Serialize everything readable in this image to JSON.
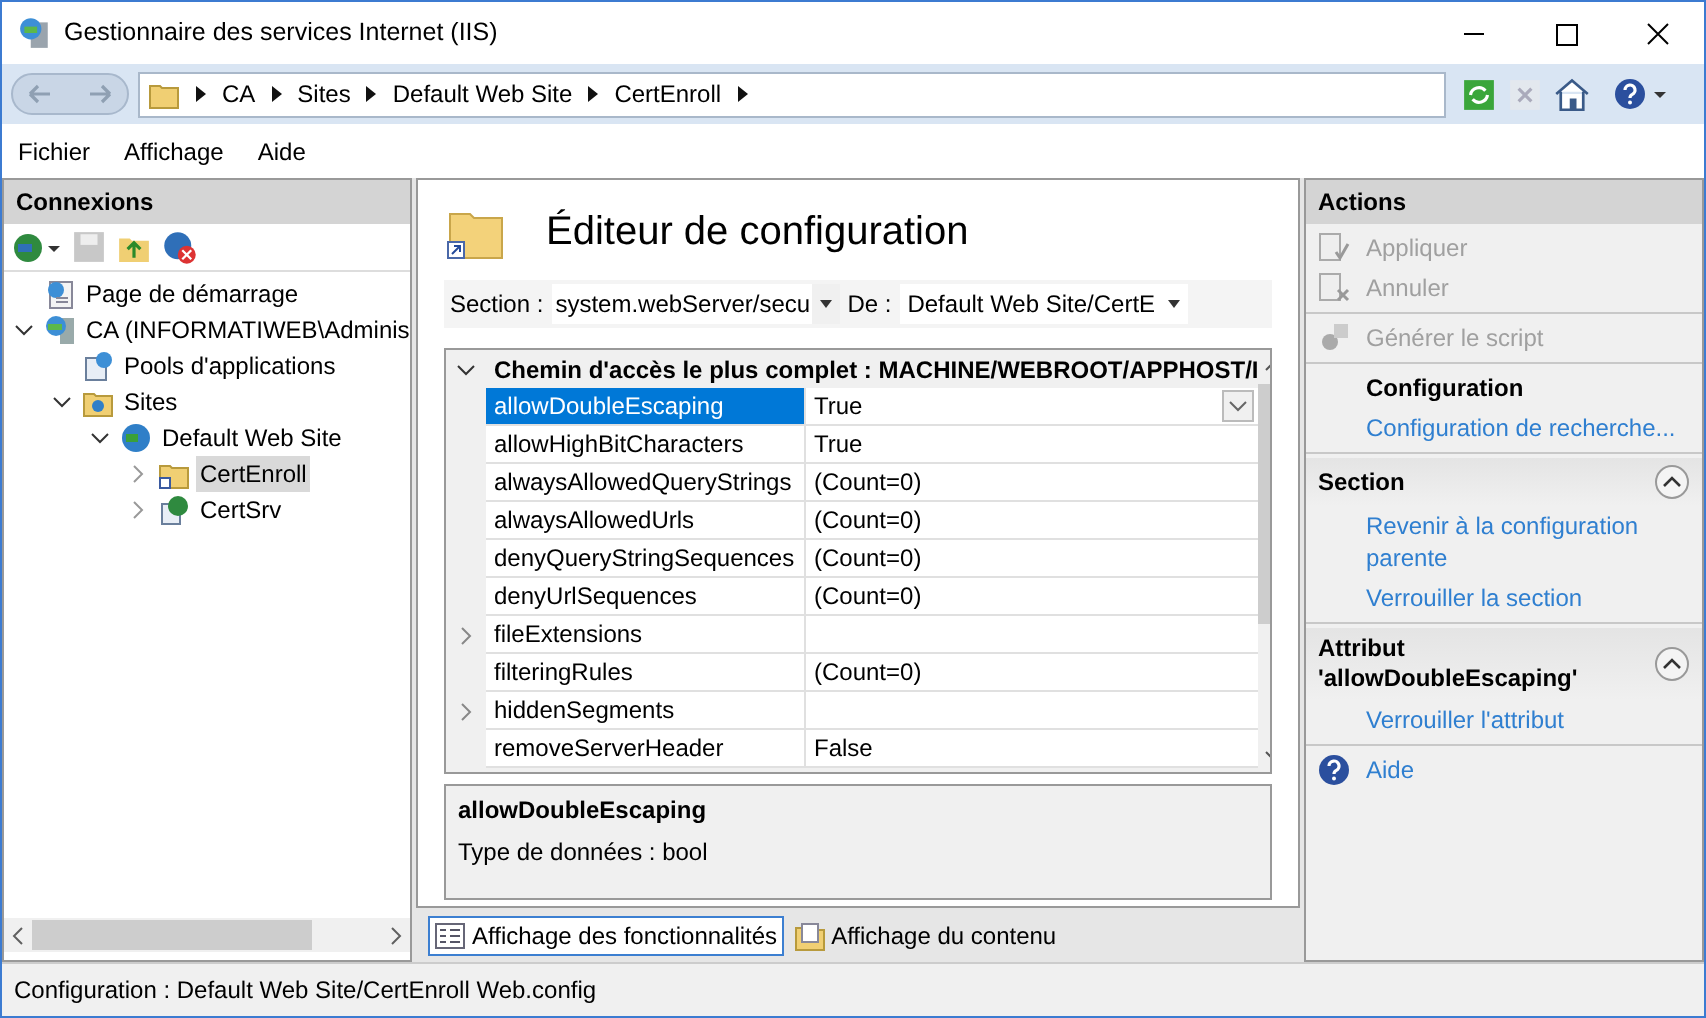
{
  "window": {
    "title": "Gestionnaire des services Internet (IIS)"
  },
  "address_bar": {
    "breadcrumb": [
      "CA",
      "Sites",
      "Default Web Site",
      "CertEnroll"
    ]
  },
  "menu": [
    "Fichier",
    "Affichage",
    "Aide"
  ],
  "connections": {
    "title": "Connexions",
    "tree": [
      {
        "label": "Page de démarrage",
        "kind": "start",
        "selected": false
      },
      {
        "label": "CA (INFORMATIWEB\\Adminis",
        "kind": "server",
        "selected": false,
        "expanded": true,
        "children": [
          {
            "label": "Pools d'applications",
            "kind": "pools",
            "selected": false
          },
          {
            "label": "Sites",
            "kind": "sites",
            "selected": false,
            "expanded": true,
            "children": [
              {
                "label": "Default Web Site",
                "kind": "globe",
                "selected": false,
                "expanded": true,
                "children": [
                  {
                    "label": "CertEnroll",
                    "kind": "folder",
                    "selected": true,
                    "expanded": false
                  },
                  {
                    "label": "CertSrv",
                    "kind": "app",
                    "selected": false,
                    "expanded": false
                  }
                ]
              }
            ]
          }
        ]
      }
    ]
  },
  "editor": {
    "title": "Éditeur de configuration",
    "section_label": "Section :",
    "section_value": "system.webServer/secu",
    "from_label": "De :",
    "from_value": "Default Web Site/CertE",
    "group_header": "Chemin d'accès le plus complet : MACHINE/WEBROOT/APPHOST/I",
    "expanded": true,
    "rows": [
      {
        "name": "allowDoubleEscaping",
        "value": "True",
        "selected": true,
        "expandable": false
      },
      {
        "name": "allowHighBitCharacters",
        "value": "True",
        "selected": false,
        "expandable": false
      },
      {
        "name": "alwaysAllowedQueryStrings",
        "value": "(Count=0)",
        "selected": false,
        "expandable": false
      },
      {
        "name": "alwaysAllowedUrls",
        "value": "(Count=0)",
        "selected": false,
        "expandable": false
      },
      {
        "name": "denyQueryStringSequences",
        "value": "(Count=0)",
        "selected": false,
        "expandable": false
      },
      {
        "name": "denyUrlSequences",
        "value": "(Count=0)",
        "selected": false,
        "expandable": false
      },
      {
        "name": "fileExtensions",
        "selected": false,
        "expandable": true
      },
      {
        "name": "filteringRules",
        "value": "(Count=0)",
        "selected": false,
        "expandable": false
      },
      {
        "name": "hiddenSegments",
        "selected": false,
        "expandable": true
      },
      {
        "name": "removeServerHeader",
        "value": "False",
        "selected": false,
        "expandable": false
      }
    ],
    "description": {
      "title": "allowDoubleEscaping",
      "text": "Type de données : bool"
    }
  },
  "view_tabs": [
    {
      "label": "Affichage des fonctionnalités",
      "kind": "features",
      "selected": true
    },
    {
      "label": "Affichage du contenu",
      "kind": "content",
      "selected": false
    }
  ],
  "actions": {
    "title": "Actions",
    "blocks": [
      {
        "kind": "group",
        "items": [
          {
            "label": "Appliquer",
            "kind": "apply",
            "disabled": true
          },
          {
            "label": "Annuler",
            "kind": "cancel",
            "disabled": true
          }
        ]
      },
      {
        "kind": "group",
        "items": [
          {
            "label": "Générer le script",
            "kind": "script",
            "disabled": true
          }
        ]
      },
      {
        "kind": "group",
        "items": [
          {
            "label": "Configuration",
            "kind": "heading",
            "disabled": false
          },
          {
            "label": "Configuration de recherche...",
            "kind": "link",
            "disabled": false
          }
        ]
      },
      {
        "kind": "section",
        "title": "Section",
        "expanded": true,
        "items": [
          {
            "label": "Revenir à la configuration parente",
            "kind": "link",
            "disabled": false
          },
          {
            "label": "Verrouiller la section",
            "kind": "link",
            "disabled": false
          }
        ]
      },
      {
        "kind": "section",
        "title": "Attribut 'allowDoubleEscaping'",
        "expanded": true,
        "items": [
          {
            "label": "Verrouiller l'attribut",
            "kind": "link",
            "disabled": false
          }
        ]
      },
      {
        "kind": "group",
        "items": [
          {
            "label": "Aide",
            "kind": "help",
            "disabled": false
          }
        ]
      }
    ]
  },
  "status_bar": "Configuration : Default Web Site/CertEnroll Web.config"
}
